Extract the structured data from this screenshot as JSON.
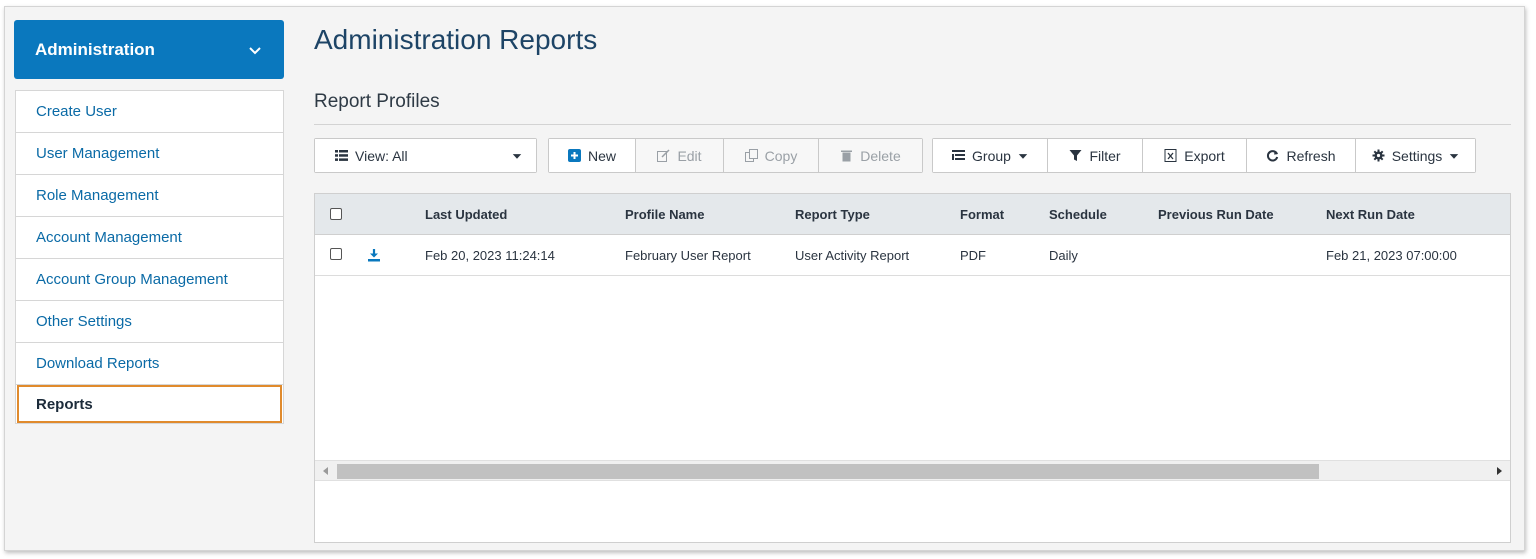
{
  "sidebar": {
    "header": "Administration",
    "items": [
      {
        "label": "Create User"
      },
      {
        "label": "User Management"
      },
      {
        "label": "Role Management"
      },
      {
        "label": "Account Management"
      },
      {
        "label": "Account Group Management"
      },
      {
        "label": "Other Settings"
      },
      {
        "label": "Download Reports"
      },
      {
        "label": "Reports",
        "active": true
      }
    ]
  },
  "page": {
    "title": "Administration Reports",
    "section": "Report Profiles"
  },
  "toolbar": {
    "view_label": "View: All",
    "new_label": "New",
    "edit_label": "Edit",
    "copy_label": "Copy",
    "delete_label": "Delete",
    "group_label": "Group",
    "filter_label": "Filter",
    "export_label": "Export",
    "refresh_label": "Refresh",
    "settings_label": "Settings"
  },
  "table": {
    "columns": [
      "Last Updated",
      "Profile Name",
      "Report Type",
      "Format",
      "Schedule",
      "Previous Run Date",
      "Next Run Date"
    ],
    "rows": [
      {
        "last_updated": "Feb 20, 2023 11:24:14",
        "profile_name": "February User Report",
        "report_type": "User Activity Report",
        "format": "PDF",
        "schedule": "Daily",
        "previous_run": "",
        "next_run": "Feb 21, 2023 07:00:00"
      }
    ]
  },
  "colors": {
    "accent": "#0a78be",
    "active_border": "#e08a2c",
    "title": "#1d4466"
  }
}
